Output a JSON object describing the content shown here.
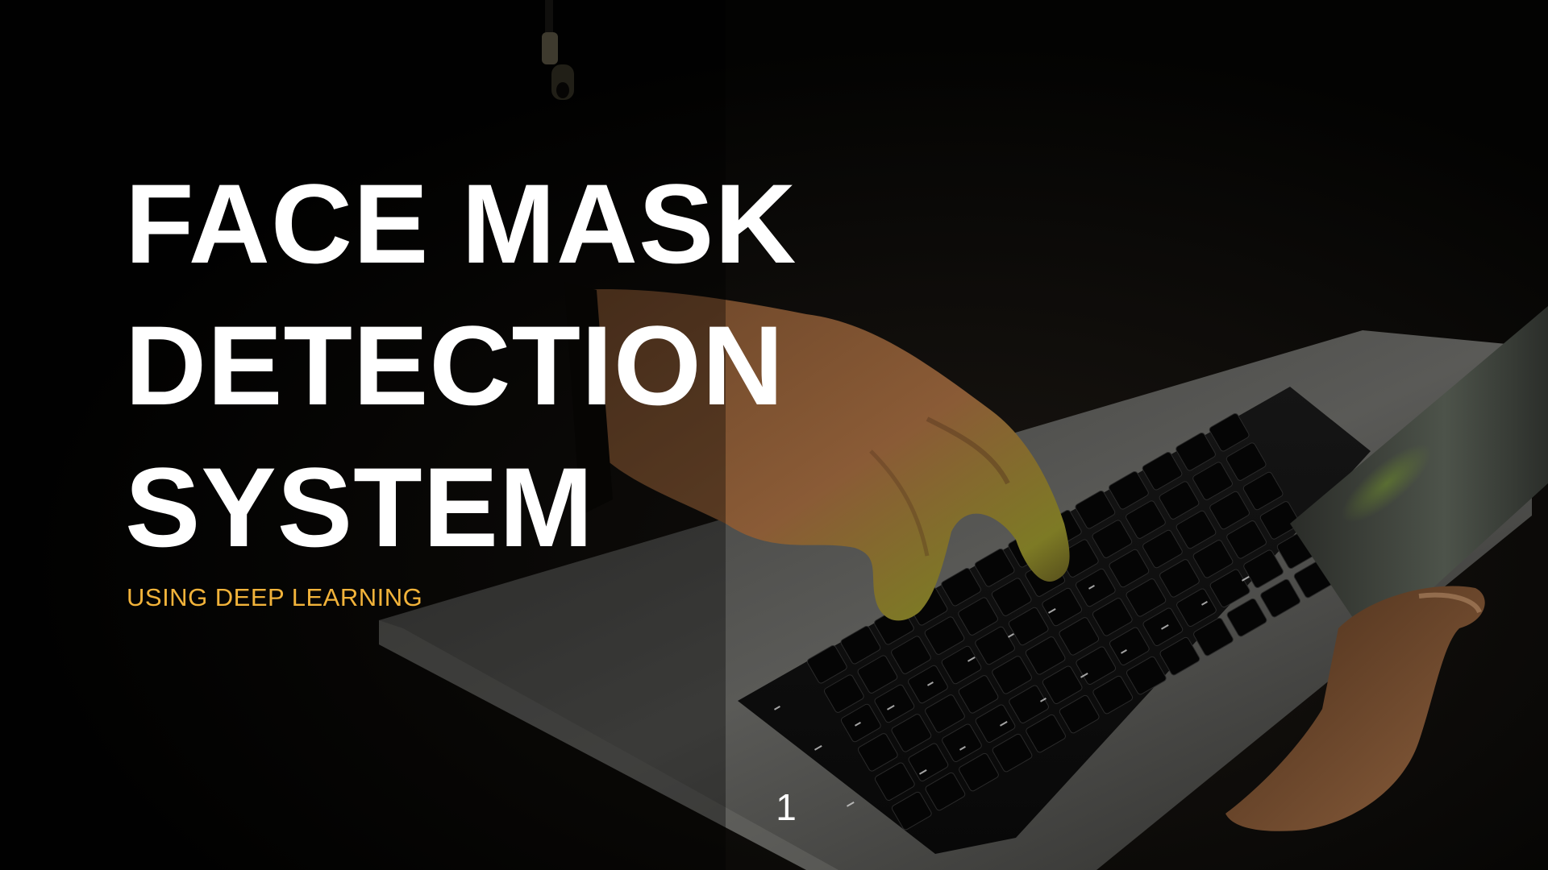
{
  "slide": {
    "title_lines": [
      "FACE MASK",
      "DETECTION",
      "SYSTEM"
    ],
    "subtitle": "USING DEEP LEARNING",
    "slide_number": "1"
  },
  "background": {
    "description_icon": "laptop-typing-photo",
    "colors": {
      "base": "#050403",
      "laptop": "#4a4a48",
      "keys": "#0b0b0b",
      "skin": "#8a5a36",
      "accent_green": "#7f9a1a",
      "subtitle": "#f2b33a"
    }
  }
}
